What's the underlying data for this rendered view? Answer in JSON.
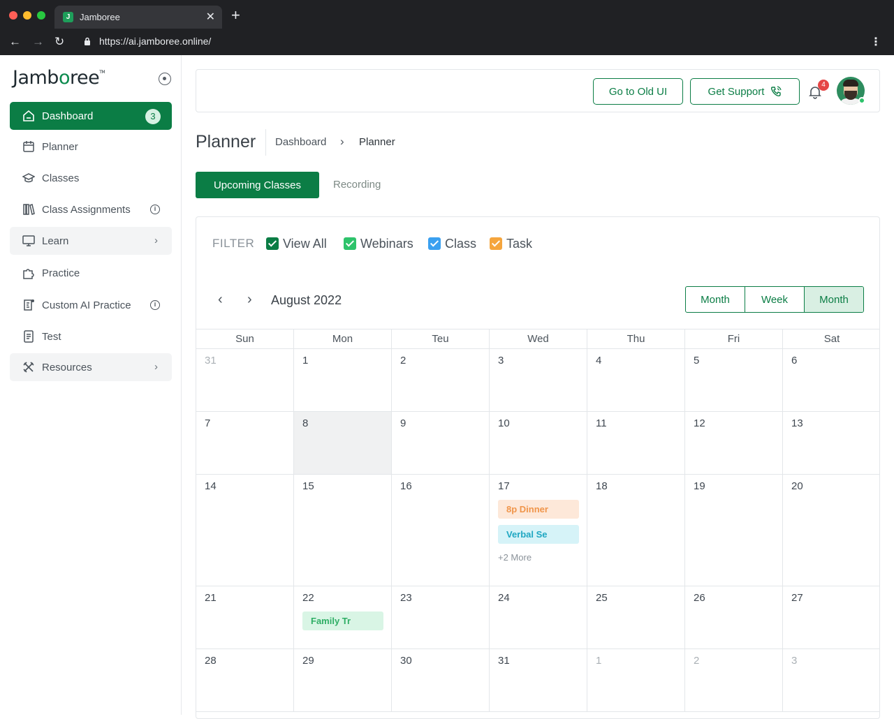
{
  "browser": {
    "tab_title": "Jamboree",
    "tab_favicon": "J",
    "url": "https://ai.jamboree.online/"
  },
  "sidebar": {
    "logo_prefix": "Jamb",
    "logo_dot": "o",
    "logo_suffix": "ree",
    "logo_tm": "TM",
    "items": [
      {
        "label": "Dashboard",
        "icon": "home-icon",
        "badge": "3"
      },
      {
        "label": "Planner",
        "icon": "calendar-icon"
      },
      {
        "label": "Classes",
        "icon": "graduation-cap-icon"
      },
      {
        "label": "Class Assignments",
        "icon": "books-icon",
        "info": "i"
      },
      {
        "label": "Learn",
        "icon": "monitor-icon",
        "chevron": "›"
      },
      {
        "label": "Practice",
        "icon": "puzzle-icon"
      },
      {
        "label": "Custom AI Practice",
        "icon": "ai-document-icon",
        "info": "i"
      },
      {
        "label": "Test",
        "icon": "document-icon"
      },
      {
        "label": "Resources",
        "icon": "tools-icon",
        "chevron": "›"
      }
    ]
  },
  "header": {
    "old_ui_label": "Go to Old UI",
    "support_label": "Get Support",
    "notification_count": "4"
  },
  "page": {
    "title": "Planner",
    "breadcrumb_root": "Dashboard",
    "breadcrumb_sep": "›",
    "breadcrumb_current": "Planner",
    "tabs": [
      "Upcoming Classes",
      "Recording"
    ]
  },
  "filter": {
    "label": "FILTER",
    "options": [
      {
        "label": "View All",
        "color": "#0b7d45"
      },
      {
        "label": "Webinars",
        "color": "#2ec36b"
      },
      {
        "label": "Class",
        "color": "#3aa0f0"
      },
      {
        "label": "Task",
        "color": "#f5a53d"
      }
    ]
  },
  "calendar": {
    "month_label": "August 2022",
    "prev": "‹",
    "next": "›",
    "views": [
      "Month",
      "Week",
      "Month"
    ],
    "weekdays": [
      "Sun",
      "Mon",
      "Teu",
      "Wed",
      "Thu",
      "Fri",
      "Sat"
    ],
    "weeks": [
      [
        "31",
        "1",
        "2",
        "3",
        "4",
        "5",
        "6"
      ],
      [
        "7",
        "8",
        "9",
        "10",
        "11",
        "12",
        "13"
      ],
      [
        "14",
        "15",
        "16",
        "17",
        "18",
        "19",
        "20"
      ],
      [
        "21",
        "22",
        "23",
        "24",
        "25",
        "26",
        "27"
      ],
      [
        "28",
        "29",
        "30",
        "31",
        "1",
        "2",
        "3"
      ]
    ],
    "events": {
      "dinner": "8p Dinner",
      "verbal": "Verbal Se",
      "more": "+2 More",
      "family": "Family Tr"
    },
    "event_colors": {
      "dinner_bg": "#fde8d9",
      "dinner_fg": "#f0954a",
      "verbal_bg": "#d6f3f8",
      "verbal_fg": "#1fa7c2",
      "family_bg": "#d9f5e5",
      "family_fg": "#2fae65"
    }
  }
}
